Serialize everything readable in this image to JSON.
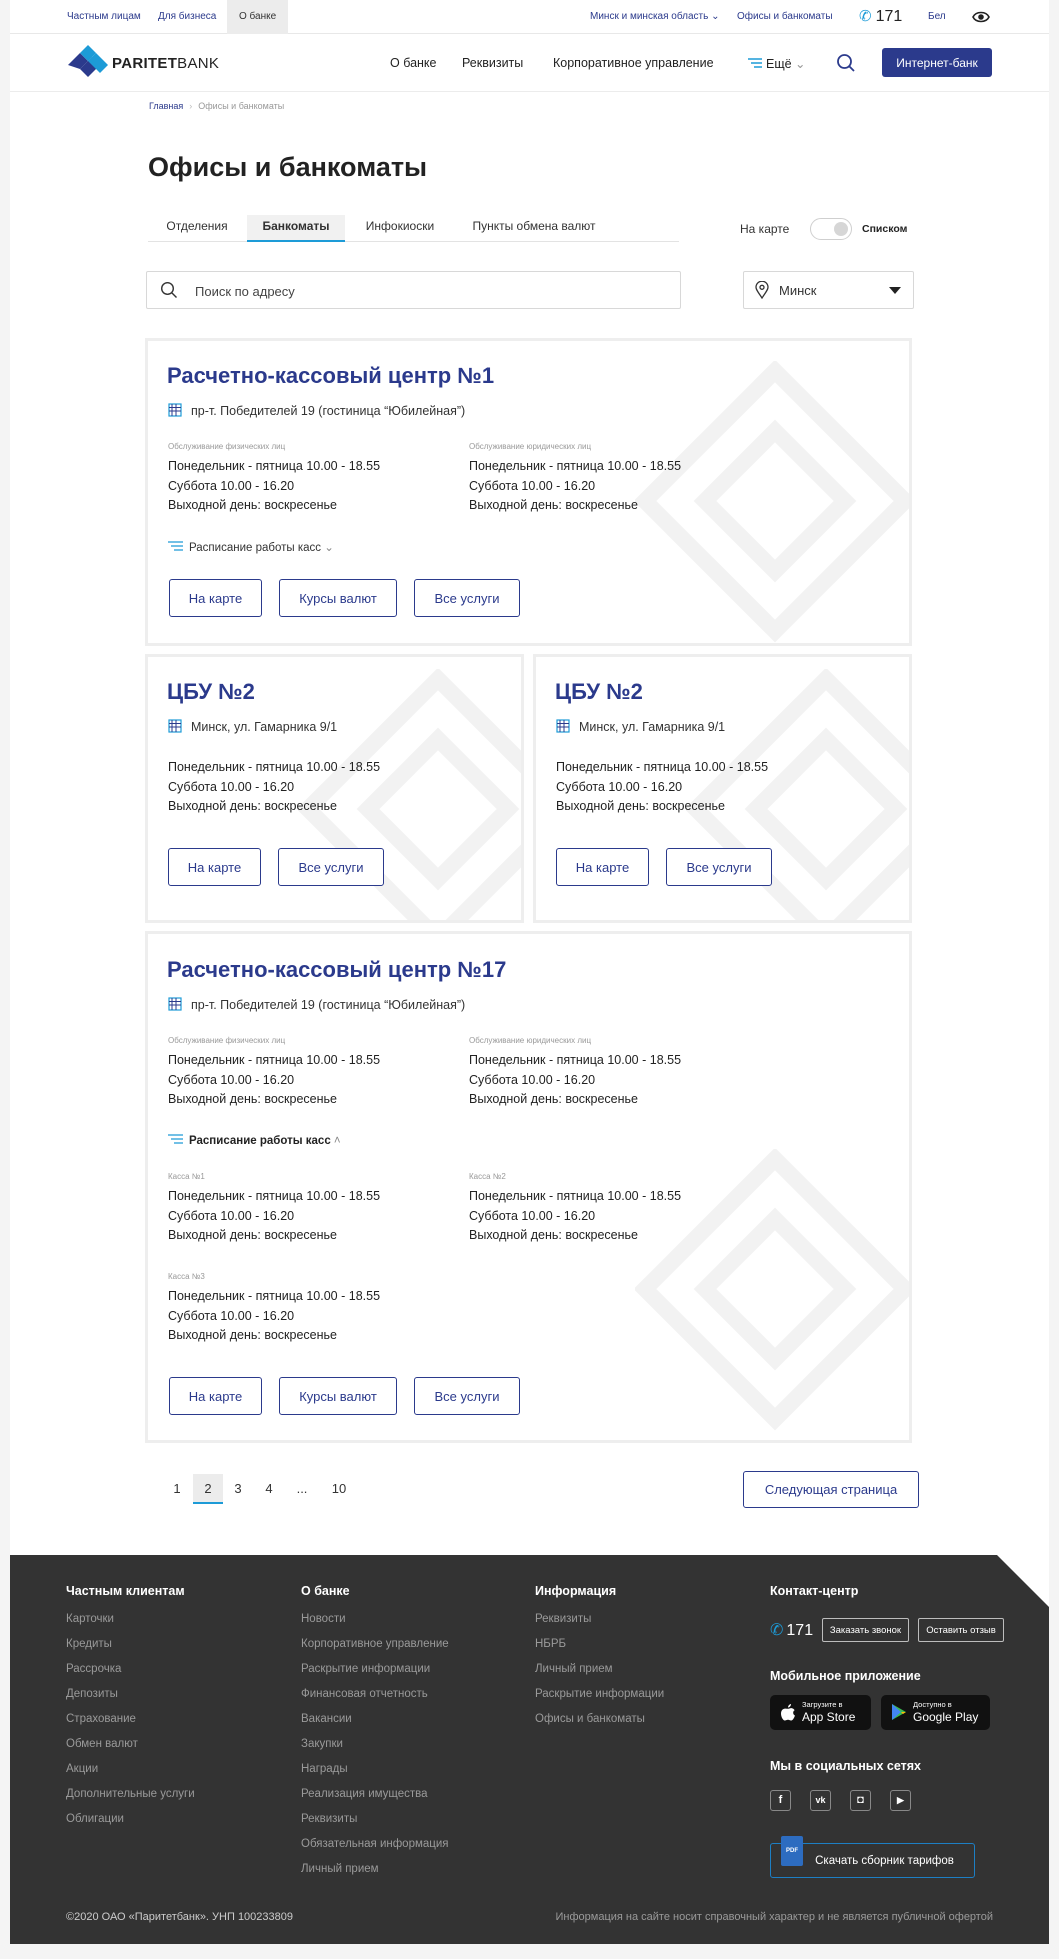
{
  "topbar": {
    "segments": [
      "Частным лицам",
      "Для бизнеса",
      "О банке"
    ],
    "region": "Минск и минская область",
    "offices_link": "Офисы и банкоматы",
    "phone": "171",
    "lang": "Бел"
  },
  "header": {
    "logo_bold": "PARITET",
    "logo_light": "BANK",
    "nav": [
      "О банке",
      "Реквизиты",
      "Корпоративное управление"
    ],
    "more": "Ещё",
    "internet_bank": "Интернет-банк"
  },
  "breadcrumb": {
    "home": "Главная",
    "current": "Офисы и банкоматы"
  },
  "page_title": "Офисы и банкоматы",
  "tabs": [
    "Отделения",
    "Банкоматы",
    "Инфокиоски",
    "Пункты обмена валют"
  ],
  "view_toggle": {
    "map_label": "На карте",
    "list_label": "Списком"
  },
  "search": {
    "placeholder": "Поиск по адресу"
  },
  "city": "Минск",
  "schedule_labels": {
    "individuals": "Обслуживание физических лиц",
    "legal": "Обслуживание юридических лиц"
  },
  "schedule_lines": {
    "weekdays": "Понедельник - пятница  10.00 - 18.55",
    "saturday": "Суббота  10.00 - 16.20",
    "dayoff": "Выходной день: воскресенье"
  },
  "cards": [
    {
      "title": "Расчетно-кассовый центр №1",
      "address": "пр-т. Победителей 19 (гостиница “Юбилейная”)",
      "cash_toggle": "Расписание работы касс",
      "buttons": [
        "На карте",
        "Курсы валют",
        "Все услуги"
      ]
    },
    {
      "title": "ЦБУ №2",
      "address": "Минск, ул. Гамарника 9/1",
      "buttons": [
        "На карте",
        "Все услуги"
      ]
    },
    {
      "title": "ЦБУ №2",
      "address": "Минск, ул. Гамарника 9/1",
      "buttons": [
        "На карте",
        "Все услуги"
      ]
    },
    {
      "title": "Расчетно-кассовый центр №17",
      "address": "пр-т. Победителей 19 (гостиница “Юбилейная”)",
      "cash_toggle": "Расписание работы касс",
      "cash_desks": [
        "Касса №1",
        "Касса №2",
        "Касса №3"
      ],
      "buttons": [
        "На карте",
        "Курсы валют",
        "Все услуги"
      ]
    }
  ],
  "pagination": {
    "pages": [
      "1",
      "2",
      "3",
      "4",
      "...",
      "10"
    ],
    "current": "2",
    "next": "Следующая страница"
  },
  "footer": {
    "col1": {
      "title": "Частным клиентам",
      "links": [
        "Карточки",
        "Кредиты",
        "Рассрочка",
        "Депозиты",
        "Страхование",
        "Обмен валют",
        "Акции",
        "Дополнительные услуги",
        "Облигации"
      ]
    },
    "col2": {
      "title": "О банке",
      "links": [
        "Новости",
        "Корпоративное управление",
        "Раскрытие информации",
        "Финансовая отчетность",
        "Вакансии",
        "Закупки",
        "Награды",
        "Реализация имущества",
        "Реквизиты",
        "Обязательная информация",
        "Личный прием"
      ]
    },
    "col3": {
      "title": "Информация",
      "links": [
        "Реквизиты",
        "НБРБ",
        "Личный прием",
        "Раскрытие информации",
        "Офисы и банкоматы"
      ]
    },
    "contact": {
      "title": "Контакт-центр",
      "phone": "171",
      "call_btn": "Заказать звонок",
      "review_btn": "Оставить отзыв"
    },
    "mobile": {
      "title": "Мобильное приложение",
      "appstore_small": "Загрузите в",
      "appstore_large": "App Store",
      "gplay_small": "Доступно в",
      "gplay_large": "Google Play"
    },
    "social": {
      "title": "Мы в социальных сетях",
      "icons": [
        "facebook-icon",
        "vk-icon",
        "instagram-icon",
        "youtube-icon"
      ]
    },
    "tariffs": "Скачать сборник тарифов",
    "pdf_label": "PDF",
    "copyright": "©2020 ОАО «Паритетбанк». УНП 100233809",
    "disclaimer": "Информация на сайте носит справочный характер и не является публичной офертой"
  },
  "colors": {
    "brand": "#2b3a8c",
    "accent": "#1d9bd7",
    "footer_bg": "#333333"
  }
}
